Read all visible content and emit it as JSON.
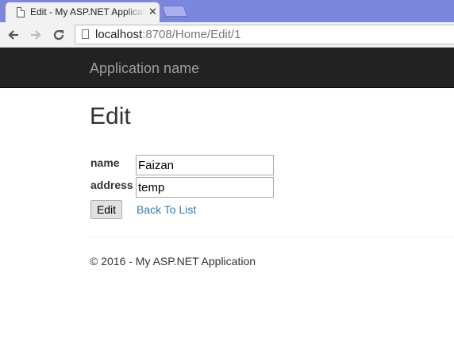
{
  "browser": {
    "tab_title": "Edit - My ASP.NET Application",
    "close_glyph": "✕",
    "url_host": "localhost",
    "url_path": ":8708/Home/Edit/1",
    "icons": [
      "back-icon",
      "forward-icon",
      "reload-icon",
      "page-icon",
      "favicon-icon",
      "close-icon"
    ]
  },
  "navbar": {
    "brand": "Application name",
    "background": "#222222"
  },
  "main": {
    "title": "Edit",
    "fields": [
      {
        "label": "name",
        "value": "Faizan"
      },
      {
        "label": "address",
        "value": "temp"
      }
    ],
    "submit_label": "Edit",
    "back_link": "Back To List"
  },
  "footer": {
    "text": "© 2016 - My ASP.NET Application"
  }
}
